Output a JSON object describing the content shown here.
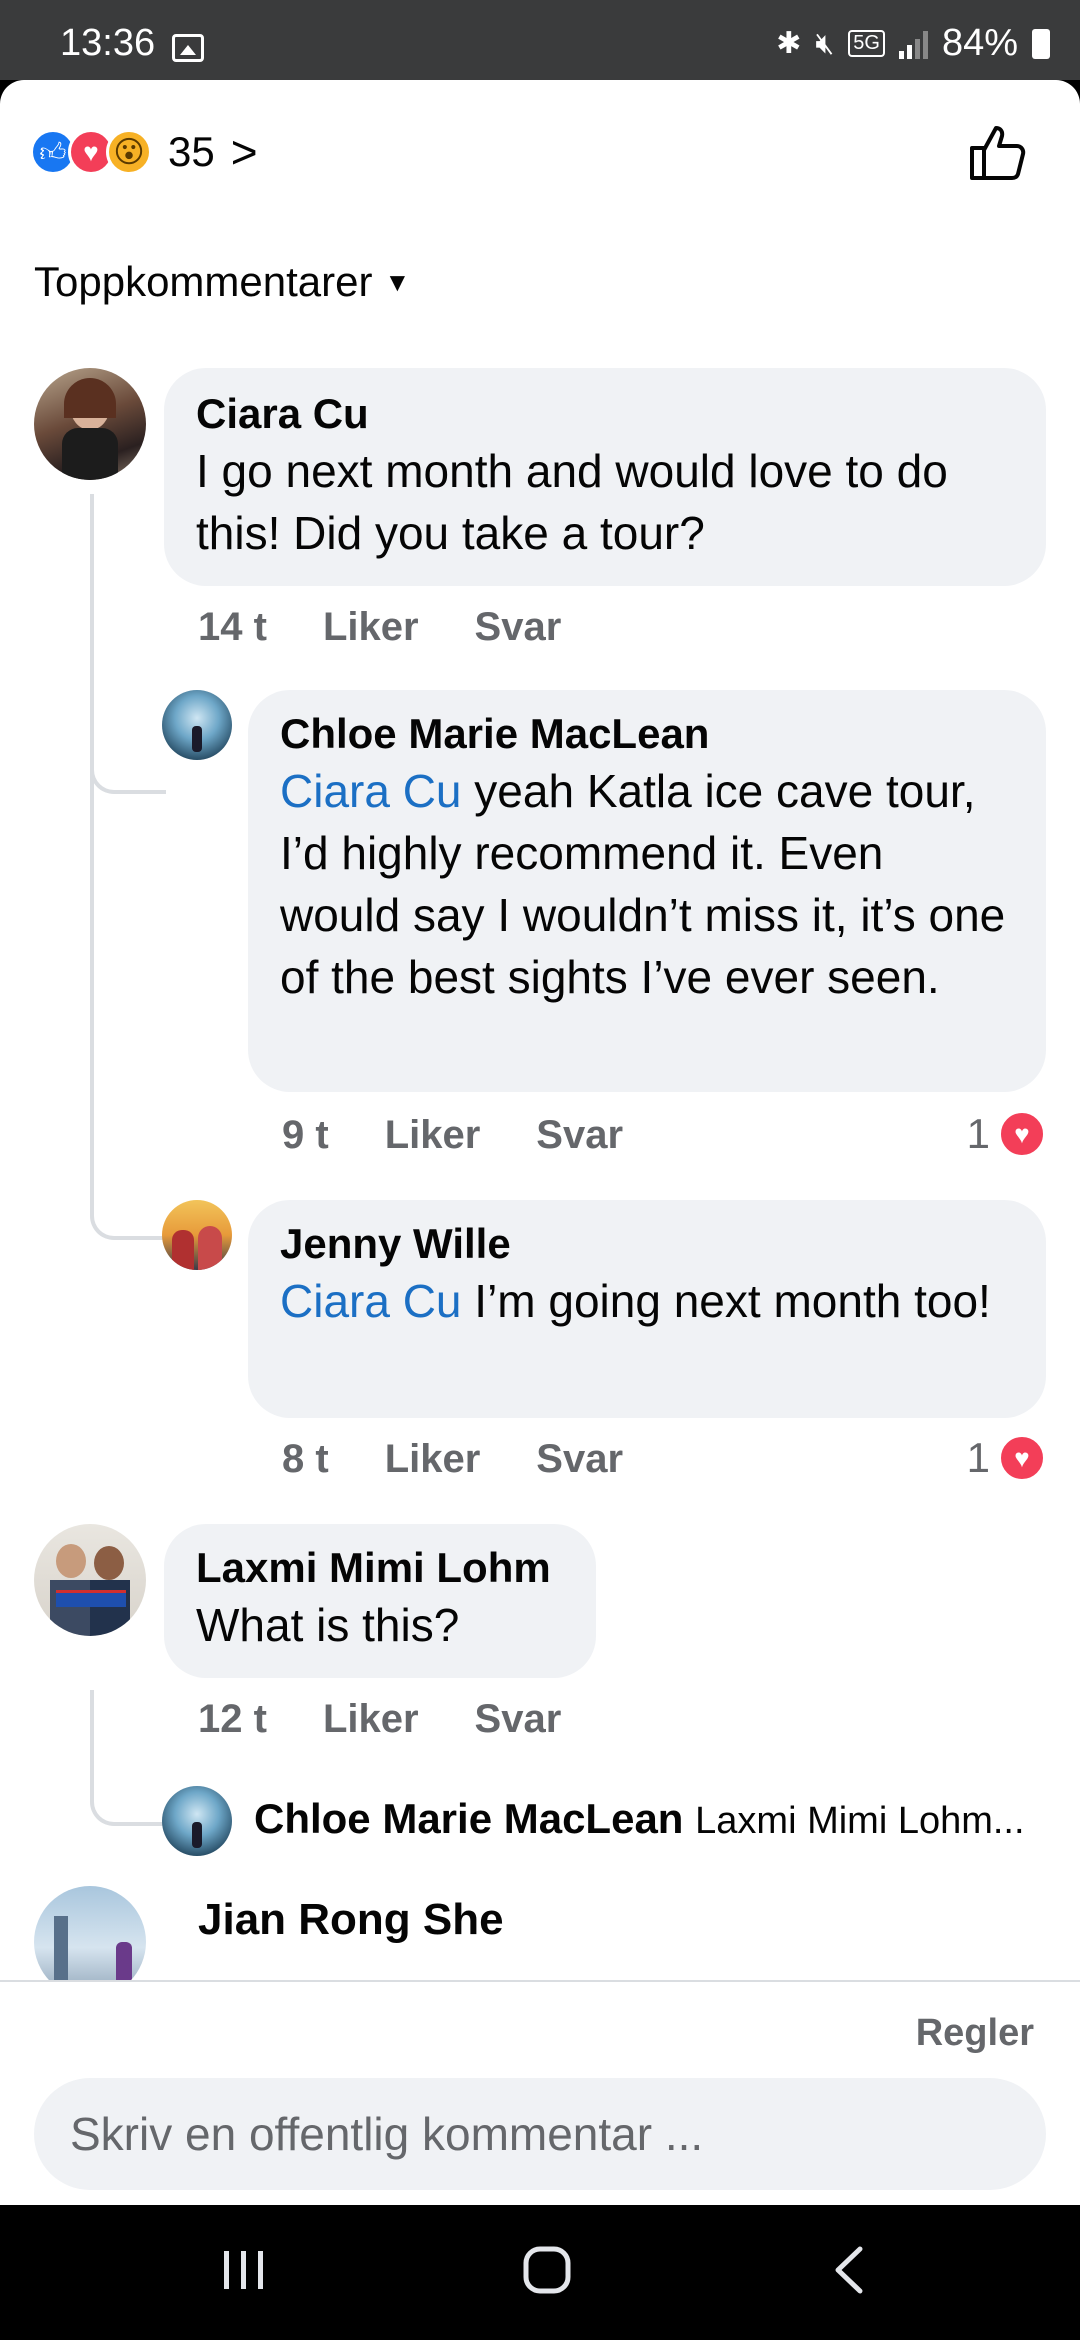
{
  "status_bar": {
    "time": "13:36",
    "network": "5G",
    "battery": "84%"
  },
  "reactions": {
    "count": "35",
    "icons": [
      "like-icon",
      "love-icon",
      "wow-icon"
    ]
  },
  "sort_label": "Toppkommentarer",
  "comments": [
    {
      "name": "Ciara Cu",
      "text": "I go next month and would love to do this! Did you take a tour?",
      "time": "14 t",
      "like": "Liker",
      "reply": "Svar"
    },
    {
      "name": "Chloe Marie MacLean",
      "mention": "Ciara Cu",
      "text": " yeah Katla ice cave tour, I’d highly recommend it. Even would say I wouldn’t miss it, it’s one of the best sights I’ve ever seen.",
      "time": "9 t",
      "like": "Liker",
      "reply": "Svar",
      "reaction_count": "1"
    },
    {
      "name": "Jenny Wille",
      "mention": "Ciara Cu",
      "text": " I’m going next month too!",
      "time": "8 t",
      "like": "Liker",
      "reply": "Svar",
      "reaction_count": "1"
    },
    {
      "name": "Laxmi Mimi Lohm",
      "text": "What is this?",
      "time": "12 t",
      "like": "Liker",
      "reply": "Svar"
    },
    {
      "name": "Chloe Marie MacLean",
      "preview": "Laxmi Mimi Lohm..."
    },
    {
      "name": "Jian Rong She"
    }
  ],
  "footer": {
    "rules": "Regler",
    "placeholder": "Skriv en offentlig kommentar ..."
  },
  "colors": {
    "accent": "#1877f2",
    "love": "#f33e58",
    "mention": "#1b6fc4",
    "bubble": "#f0f2f5",
    "muted": "#65676b"
  }
}
